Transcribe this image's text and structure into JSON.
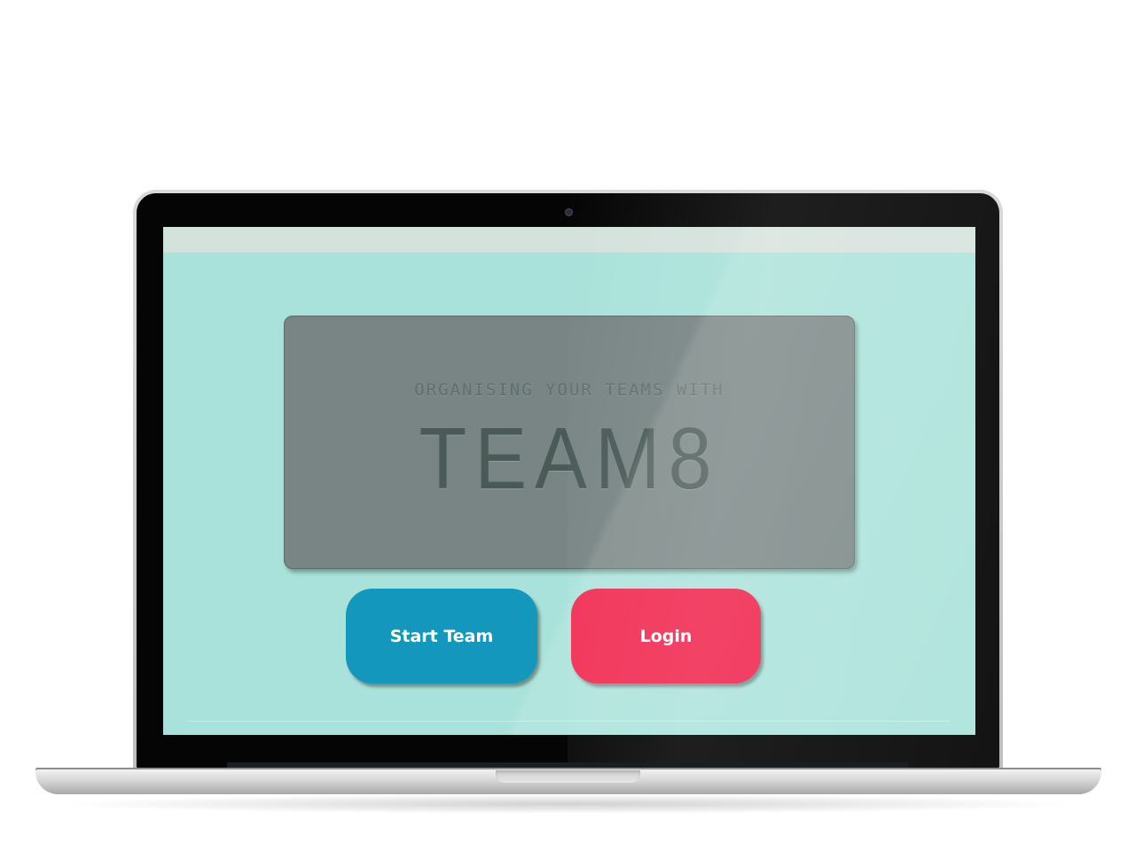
{
  "hero": {
    "subtitle": "ORGANISING YOUR TEAMS WITH",
    "title": "TEAM8"
  },
  "buttons": {
    "start_team_label": "Start Team",
    "login_label": "Login"
  },
  "colors": {
    "background": "#a9e2da",
    "topbar": "#d4e2dc",
    "hero_card": "#788584",
    "hero_text": "#4a5a57",
    "start_team": "#1397bd",
    "login": "#f01b45"
  }
}
